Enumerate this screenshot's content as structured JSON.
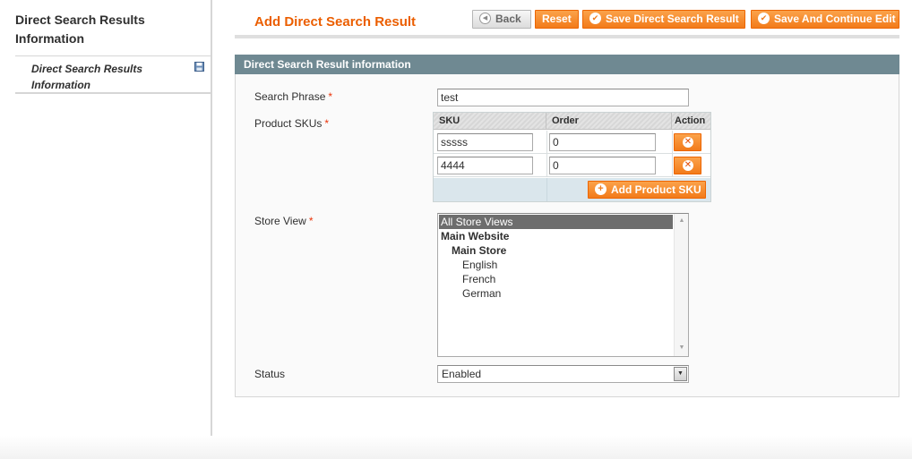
{
  "sidebar": {
    "title": "Direct Search Results Information",
    "items": [
      {
        "label": "Direct Search Results Information",
        "icon": "save-icon"
      }
    ]
  },
  "header": {
    "title": "Add Direct Search Result",
    "buttons": {
      "back": "Back",
      "reset": "Reset",
      "save": "Save Direct Search Result",
      "save_continue": "Save And Continue Edit"
    }
  },
  "fieldset": {
    "title": "Direct Search Result information",
    "required_mark": "*",
    "search_phrase": {
      "label": "Search Phrase",
      "value": "test"
    },
    "product_skus": {
      "label": "Product SKUs",
      "columns": [
        "SKU",
        "Order",
        "Action"
      ],
      "rows": [
        {
          "sku": "sssss",
          "order": "0"
        },
        {
          "sku": "4444",
          "order": "0"
        }
      ],
      "add_button": "Add Product SKU"
    },
    "store_view": {
      "label": "Store View",
      "options": [
        {
          "label": "All Store Views",
          "selected": true
        },
        {
          "label": "Main Website"
        },
        {
          "label": "Main Store"
        },
        {
          "label": "English"
        },
        {
          "label": "French"
        },
        {
          "label": "German"
        }
      ]
    },
    "status": {
      "label": "Status",
      "value": "Enabled"
    }
  },
  "colors": {
    "accent_orange": "#eb5e00",
    "button_orange": "#f27b1a",
    "fieldset_header": "#6f8992",
    "required_red": "#eb340a"
  }
}
